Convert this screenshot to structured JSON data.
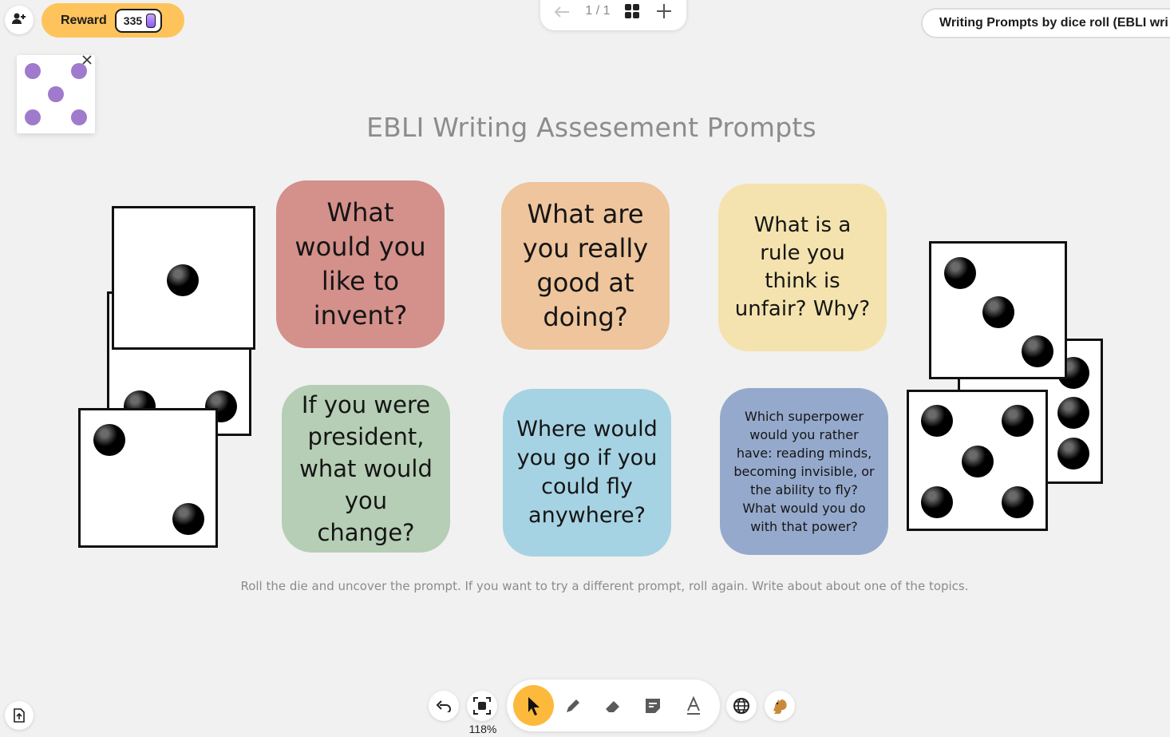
{
  "topbar": {
    "reward_label": "Reward",
    "reward_count": "335",
    "page_counter": "1 / 1",
    "board_title": "Writing Prompts by dice roll (EBLI wri"
  },
  "board": {
    "title": "EBLI Writing Assesement Prompts",
    "instructions": "Roll the die and uncover the prompt. If you want to try a different prompt, roll again. Write about about one of the topics."
  },
  "prompts": [
    {
      "text": "What would you like to invent?",
      "color": "#d4908a"
    },
    {
      "text": "What are you really good at doing?",
      "color": "#eec59c"
    },
    {
      "text": "What is a rule you think is unfair? Why?",
      "color": "#f4e3ae"
    },
    {
      "text": "If you were president, what would you change?",
      "color": "#b5ceb5"
    },
    {
      "text": "Where would you go if you could fly anywhere?",
      "color": "#a6d3e3"
    },
    {
      "text": "Which superpower would you rather have: reading minds, becoming invisible, or the ability to fly? What would you do with that power?",
      "color": "#95a9cc"
    }
  ],
  "dice": {
    "widget_value": 5,
    "widget_pip_color": "#a07acc"
  },
  "bottombar": {
    "zoom": "118%"
  },
  "icons": {
    "add_user": "add-user-icon",
    "gem": "gem-icon",
    "close": "close-icon",
    "prev": "arrow-left-icon",
    "grid": "grid-icon",
    "plus": "plus-icon",
    "undo": "undo-icon",
    "fit": "fit-to-screen-icon",
    "select": "pointer-icon",
    "pen": "pen-icon",
    "eraser": "eraser-icon",
    "sticky": "sticky-note-icon",
    "text": "text-icon",
    "globe": "globe-icon",
    "squirrel": "squirrel-icon",
    "export": "export-icon"
  }
}
